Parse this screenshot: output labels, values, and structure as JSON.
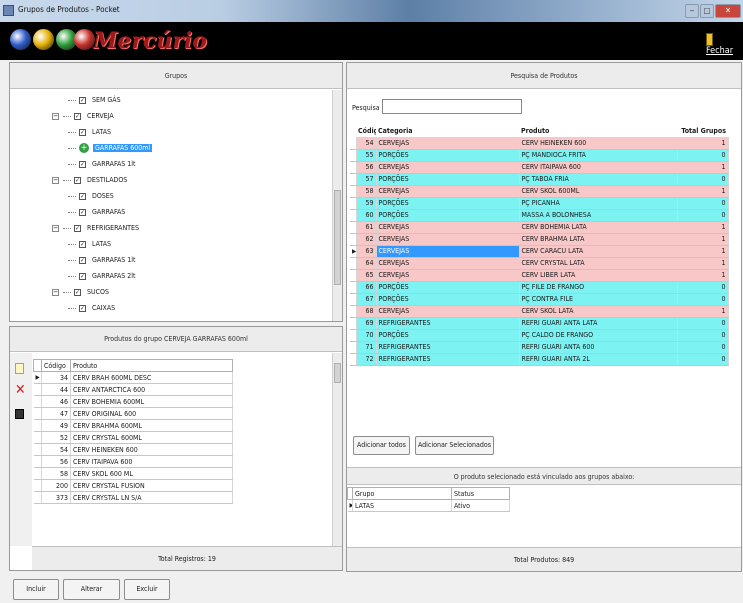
{
  "window": {
    "title": "Grupos de Produtos - Pocket"
  },
  "window_controls": {
    "min": "‒",
    "max": "□",
    "close": "✕"
  },
  "brand": {
    "name": "Mercúrio",
    "ball_colors": [
      "#2f5dcc",
      "#e5b20a",
      "#2e9e3a",
      "#c8322b"
    ],
    "exit_label": "Fechar"
  },
  "groups_panel": {
    "header": "Grupos",
    "tree": [
      {
        "label": "SEM GÁS",
        "level": 3,
        "checked": true,
        "expander": ""
      },
      {
        "label": "CERVEJA",
        "level": 2,
        "checked": true,
        "expander": "−"
      },
      {
        "label": "LATAS",
        "level": 3,
        "checked": true,
        "expander": ""
      },
      {
        "label": "GARRAFAS 600ml",
        "level": 3,
        "checked": false,
        "expander": "",
        "selected": true,
        "add_icon": true
      },
      {
        "label": "GARRAFAS 1lt",
        "level": 3,
        "checked": true,
        "expander": ""
      },
      {
        "label": "DESTILADOS",
        "level": 2,
        "checked": true,
        "expander": "−"
      },
      {
        "label": "DOSES",
        "level": 3,
        "checked": true,
        "expander": ""
      },
      {
        "label": "GARRAFAS",
        "level": 3,
        "checked": true,
        "expander": ""
      },
      {
        "label": "REFRIGERANTES",
        "level": 2,
        "checked": true,
        "expander": "−"
      },
      {
        "label": "LATAS",
        "level": 3,
        "checked": true,
        "expander": ""
      },
      {
        "label": "GARRAFAS 1lt",
        "level": 3,
        "checked": true,
        "expander": ""
      },
      {
        "label": "GARRAFAS 2lt",
        "level": 3,
        "checked": true,
        "expander": ""
      },
      {
        "label": "SUCOS",
        "level": 2,
        "checked": true,
        "expander": "−"
      },
      {
        "label": "CAIXAS",
        "level": 3,
        "checked": true,
        "expander": ""
      }
    ]
  },
  "group_products": {
    "header": "Produtos do grupo CERVEJA GARRAFAS 600ml",
    "columns": [
      "Código",
      "Produto"
    ],
    "rows": [
      [
        "34",
        "CERV BRAH 600ML DESC"
      ],
      [
        "44",
        "CERV ANTARCTICA 600"
      ],
      [
        "46",
        "CERV BOHEMIA 600ML"
      ],
      [
        "47",
        "CERV ORIGINAL 600"
      ],
      [
        "49",
        "CERV BRAHMA 600ML"
      ],
      [
        "52",
        "CERV CRYSTAL 600ML"
      ],
      [
        "54",
        "CERV HEINEKEN 600"
      ],
      [
        "56",
        "CERV ITAIPAVA 600"
      ],
      [
        "58",
        "CERV SKOL 600 ML"
      ],
      [
        "200",
        "CERV CRYSTAL FUSION"
      ],
      [
        "373",
        "CERV CRYSTAL LN S/A"
      ]
    ],
    "footer": "Total Registros: 19",
    "side_icons": [
      "new-doc-icon",
      "delete-x-icon",
      "save-disk-icon"
    ]
  },
  "product_search": {
    "header": "Pesquisa de Produtos",
    "search_label": "Pesquisa",
    "search_value": "",
    "columns": [
      "Código",
      "Categoria",
      "Produto",
      "Total Grupos"
    ],
    "rows": [
      {
        "code": "54",
        "category": "CERVEJAS",
        "product": "CERV HEINEKEN 600",
        "total": "1",
        "color": "pink"
      },
      {
        "code": "55",
        "category": "PORÇÕES",
        "product": "PÇ MANDIOCA FRITA",
        "total": "0",
        "color": "cyan"
      },
      {
        "code": "56",
        "category": "CERVEJAS",
        "product": "CERV ITAIPAVA 600",
        "total": "1",
        "color": "pink"
      },
      {
        "code": "57",
        "category": "PORÇÕES",
        "product": "PÇ TABOA FRIA",
        "total": "0",
        "color": "cyan"
      },
      {
        "code": "58",
        "category": "CERVEJAS",
        "product": "CERV SKOL 600ML",
        "total": "1",
        "color": "pink"
      },
      {
        "code": "59",
        "category": "PORÇÕES",
        "product": "PÇ PICANHA",
        "total": "0",
        "color": "cyan"
      },
      {
        "code": "60",
        "category": "PORÇÕES",
        "product": "MASSA A BOLONHESA",
        "total": "0",
        "color": "cyan"
      },
      {
        "code": "61",
        "category": "CERVEJAS",
        "product": "CERV BOHEMIA LATA",
        "total": "1",
        "color": "pink"
      },
      {
        "code": "62",
        "category": "CERVEJAS",
        "product": "CERV BRAHMA LATA",
        "total": "1",
        "color": "pink"
      },
      {
        "code": "63",
        "category": "CERVEJAS",
        "product": "CERV CARACU LATA",
        "total": "1",
        "color": "pink",
        "current": true
      },
      {
        "code": "64",
        "category": "CERVEJAS",
        "product": "CERV CRYSTAL LATA",
        "total": "1",
        "color": "pink"
      },
      {
        "code": "65",
        "category": "CERVEJAS",
        "product": "CERV LIBER LATA",
        "total": "1",
        "color": "pink"
      },
      {
        "code": "66",
        "category": "PORÇÕES",
        "product": "PÇ FILE DE FRANGO",
        "total": "0",
        "color": "cyan"
      },
      {
        "code": "67",
        "category": "PORÇÕES",
        "product": "PÇ CONTRA FILE",
        "total": "0",
        "color": "cyan"
      },
      {
        "code": "68",
        "category": "CERVEJAS",
        "product": "CERV SKOL LATA",
        "total": "1",
        "color": "pink"
      },
      {
        "code": "69",
        "category": "REFRIGERANTES",
        "product": "REFRI GUARI ANTA LATA",
        "total": "0",
        "color": "cyan"
      },
      {
        "code": "70",
        "category": "PORÇÕES",
        "product": "PÇ CALDO DE FRANGO",
        "total": "0",
        "color": "cyan"
      },
      {
        "code": "71",
        "category": "REFRIGERANTES",
        "product": "REFRI GUARI ANTA 600",
        "total": "0",
        "color": "cyan"
      },
      {
        "code": "72",
        "category": "REFRIGERANTES",
        "product": "REFRI GUARI ANTA 2L",
        "total": "0",
        "color": "cyan"
      }
    ],
    "btn_add_all": "Adicionar todos",
    "btn_add_selected": "Adicionar Selecionados",
    "linked_header": "O produto selecionado está vinculado aos grupos abaixo:",
    "linked_columns": [
      "Grupo",
      "Status"
    ],
    "linked_rows": [
      [
        "LATAS",
        "Ativo"
      ]
    ],
    "footer": "Total Produtos: 849"
  },
  "bottom_buttons": {
    "include": "Incluir",
    "alter": "Alterar",
    "delete": "Excluir"
  },
  "colors": {
    "row_pink": "#f8c7c7",
    "row_cyan": "#7cf2f2",
    "selection": "#3399ff"
  }
}
